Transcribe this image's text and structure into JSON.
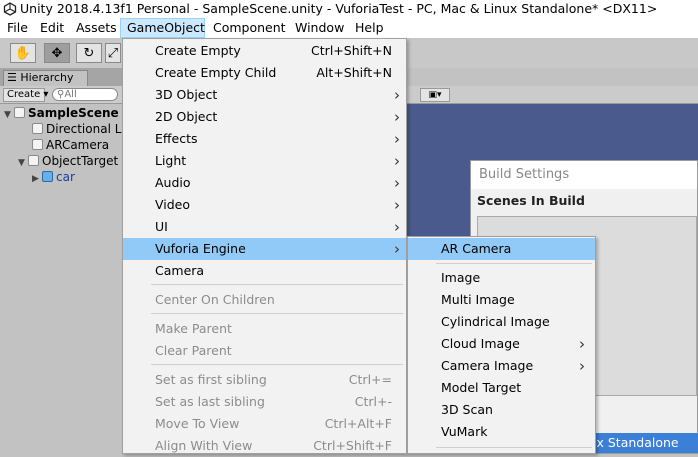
{
  "window": {
    "title": "Unity 2018.4.13f1 Personal - SampleScene.unity - VuforiaTest - PC, Mac & Linux Standalone* <DX11>"
  },
  "menubar": [
    "File",
    "Edit",
    "Assets",
    "GameObject",
    "Component",
    "Window",
    "Help"
  ],
  "hierarchy": {
    "tab": "Hierarchy",
    "create": "Create",
    "search_placeholder": "All",
    "items": [
      "SampleScene",
      "Directional Light",
      "ARCamera",
      "ObjectTarget",
      "car"
    ]
  },
  "gameobject_menu": [
    {
      "label": "Create Empty",
      "shortcut": "Ctrl+Shift+N"
    },
    {
      "label": "Create Empty Child",
      "shortcut": "Alt+Shift+N"
    },
    {
      "label": "3D Object",
      "submenu": true
    },
    {
      "label": "2D Object",
      "submenu": true
    },
    {
      "label": "Effects",
      "submenu": true
    },
    {
      "label": "Light",
      "submenu": true
    },
    {
      "label": "Audio",
      "submenu": true
    },
    {
      "label": "Video",
      "submenu": true
    },
    {
      "label": "UI",
      "submenu": true
    },
    {
      "label": "Vuforia Engine",
      "submenu": true,
      "highlighted": true
    },
    {
      "label": "Camera"
    },
    {
      "label": "Center On Children",
      "disabled": true
    },
    {
      "label": "Make Parent",
      "disabled": true
    },
    {
      "label": "Clear Parent",
      "disabled": true
    },
    {
      "label": "Set as first sibling",
      "shortcut": "Ctrl+=",
      "disabled": true
    },
    {
      "label": "Set as last sibling",
      "shortcut": "Ctrl+-",
      "disabled": true
    },
    {
      "label": "Move To View",
      "shortcut": "Ctrl+Alt+F",
      "disabled": true
    },
    {
      "label": "Align With View",
      "shortcut": "Ctrl+Shift+F",
      "disabled": true
    }
  ],
  "vuforia_menu": [
    {
      "label": "AR Camera",
      "highlighted": true
    },
    {
      "label": "Image"
    },
    {
      "label": "Multi Image"
    },
    {
      "label": "Cylindrical Image"
    },
    {
      "label": "Cloud Image",
      "submenu": true
    },
    {
      "label": "Camera Image",
      "submenu": true
    },
    {
      "label": "Model Target"
    },
    {
      "label": "3D Scan"
    },
    {
      "label": "VuMark"
    }
  ],
  "build_settings": {
    "title": "Build Settings",
    "scenes_header": "Scenes In Build",
    "platform": "PC, Mac & Linux Standalone"
  },
  "colors": {
    "highlight": "#91c9f7",
    "menu_active": "#cce8ff",
    "scene_bg": "#4a5a8c"
  }
}
